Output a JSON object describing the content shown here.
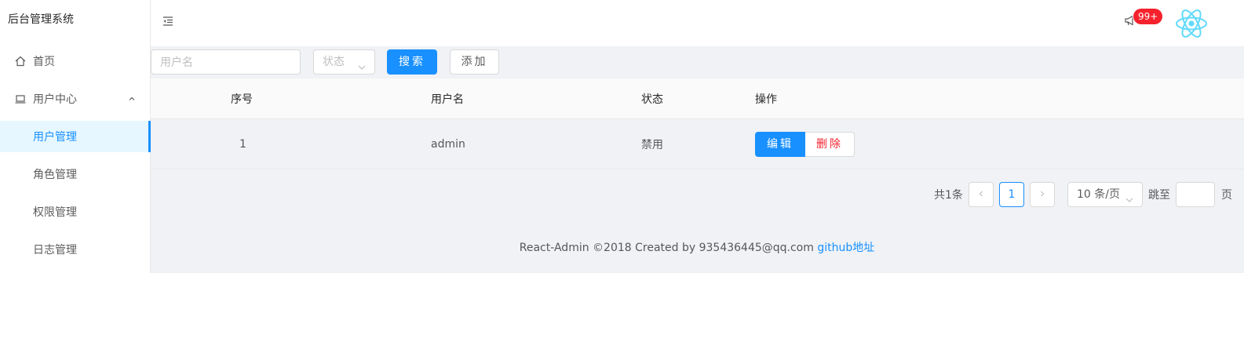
{
  "app": {
    "title": "后台管理系统"
  },
  "sidebar": {
    "items": [
      {
        "label": "首页",
        "icon": "home-icon"
      },
      {
        "label": "用户中心",
        "icon": "laptop-icon",
        "expanded": true
      },
      {
        "label": "用户管理",
        "selected": true
      },
      {
        "label": "角色管理"
      },
      {
        "label": "权限管理"
      },
      {
        "label": "日志管理"
      }
    ]
  },
  "header": {
    "badge": "99+"
  },
  "search": {
    "username_placeholder": "用户名",
    "status_placeholder": "状态",
    "search_button": "搜索",
    "add_button": "添加"
  },
  "table": {
    "columns": [
      "序号",
      "用户名",
      "状态",
      "操作"
    ],
    "rows": [
      {
        "index": "1",
        "username": "admin",
        "status": "禁用",
        "edit": "编辑",
        "delete": "删除"
      }
    ]
  },
  "pagination": {
    "total": "共1条",
    "current": "1",
    "page_size": "10 条/页",
    "jump_label": "跳至",
    "jump_suffix": "页"
  },
  "footer": {
    "text": "React-Admin ©2018 Created by 935436445@qq.com ",
    "link": "github地址"
  },
  "colors": {
    "primary": "#1890ff",
    "danger": "#f5222d",
    "bg": "#f0f2f5"
  }
}
